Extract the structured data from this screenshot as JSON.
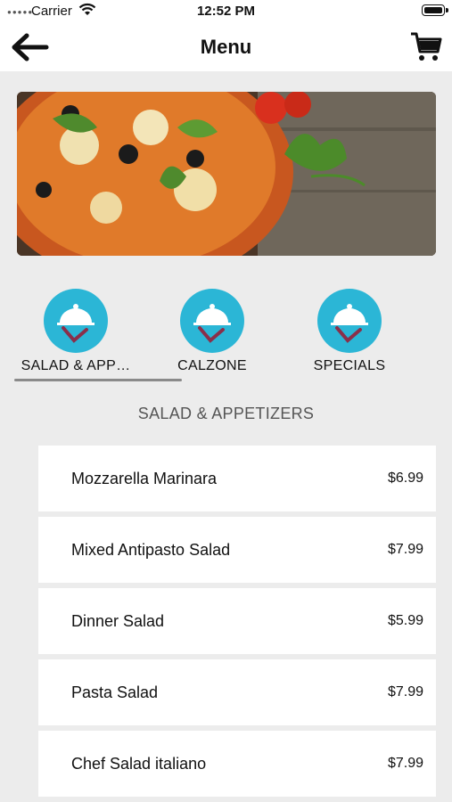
{
  "status_bar": {
    "carrier": "Carrier",
    "time": "12:52 PM"
  },
  "nav": {
    "title": "Menu",
    "back_icon": "arrow-left-icon",
    "cart_icon": "shopping-cart-icon"
  },
  "categories": [
    {
      "label": "SALAD & APP…",
      "icon": "cloche-icon",
      "selected": true
    },
    {
      "label": "CALZONE",
      "icon": "cloche-icon",
      "selected": false
    },
    {
      "label": "SPECIALS",
      "icon": "cloche-icon",
      "selected": false
    }
  ],
  "section_title": "SALAD & APPETIZERS",
  "items": [
    {
      "name": "Mozzarella Marinara",
      "price": "$6.99"
    },
    {
      "name": "Mixed Antipasto Salad",
      "price": "$7.99"
    },
    {
      "name": "Dinner Salad",
      "price": "$5.99"
    },
    {
      "name": "Pasta Salad",
      "price": "$7.99"
    },
    {
      "name": "Chef Salad italiano",
      "price": "$7.99"
    }
  ],
  "colors": {
    "accent": "#2bb6d6",
    "background": "#ececec"
  }
}
